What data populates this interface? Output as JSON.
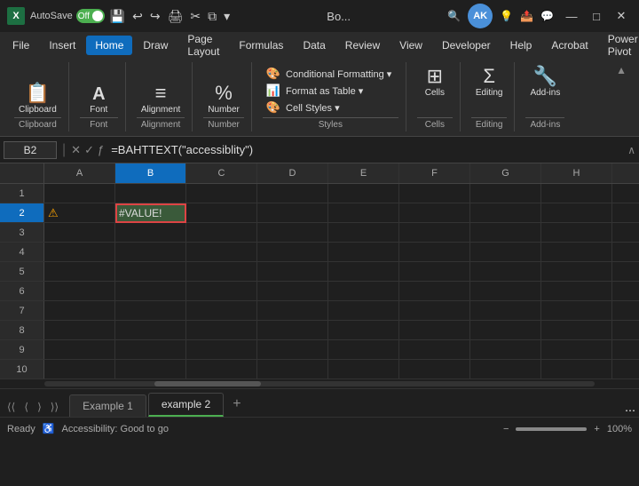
{
  "titlebar": {
    "app_icon": "X",
    "autosave_label": "AutoSave",
    "toggle_state": "Off",
    "filename": "Bo...",
    "window_controls": {
      "minimize": "—",
      "maximize": "□",
      "close": "✕"
    }
  },
  "menubar": {
    "items": [
      {
        "id": "file",
        "label": "File"
      },
      {
        "id": "insert",
        "label": "Insert"
      },
      {
        "id": "home",
        "label": "Home",
        "active": true
      },
      {
        "id": "draw",
        "label": "Draw"
      },
      {
        "id": "page-layout",
        "label": "Page Layout"
      },
      {
        "id": "formulas",
        "label": "Formulas"
      },
      {
        "id": "data",
        "label": "Data"
      },
      {
        "id": "review",
        "label": "Review"
      },
      {
        "id": "view",
        "label": "View"
      },
      {
        "id": "developer",
        "label": "Developer"
      },
      {
        "id": "help",
        "label": "Help"
      },
      {
        "id": "acrobat",
        "label": "Acrobat"
      },
      {
        "id": "power-pivot",
        "label": "Power Pivot"
      }
    ]
  },
  "ribbon": {
    "groups": [
      {
        "id": "clipboard",
        "label": "Clipboard",
        "icon": "📋"
      },
      {
        "id": "font",
        "label": "Font",
        "icon": "A"
      },
      {
        "id": "alignment",
        "label": "Alignment",
        "icon": "≡"
      },
      {
        "id": "number",
        "label": "Number",
        "icon": "%"
      },
      {
        "id": "styles",
        "label": "Styles",
        "items": [
          {
            "icon": "🎨",
            "label": "Conditional Formatting ▾"
          },
          {
            "icon": "📊",
            "label": "Format as Table ▾"
          },
          {
            "icon": "🎨",
            "label": "Cell Styles ▾"
          }
        ]
      },
      {
        "id": "cells",
        "label": "Cells",
        "icon": "⊞"
      },
      {
        "id": "editing",
        "label": "Editing",
        "icon": "Σ"
      },
      {
        "id": "add-ins",
        "label": "Add-ins",
        "icon": "🔧"
      }
    ],
    "section_labels": {
      "styles": "Styles",
      "add_ins": "Add-ins"
    }
  },
  "formula_bar": {
    "cell_ref": "B2",
    "formula": "=BAHTTEXT(\"accessiblity\")",
    "icons": [
      "✕",
      "✓",
      "ƒ"
    ]
  },
  "spreadsheet": {
    "col_headers": [
      "A",
      "B",
      "C",
      "D",
      "E",
      "F",
      "G",
      "H"
    ],
    "active_col": "B",
    "rows": [
      1,
      2,
      3,
      4,
      5,
      6,
      7,
      8,
      9,
      10
    ],
    "active_row": 2,
    "selected_cell": {
      "row": 2,
      "col": "B",
      "value": "#VALUE!",
      "has_warning": true
    }
  },
  "sheet_tabs": {
    "tabs": [
      {
        "id": "example1",
        "label": "Example 1",
        "active": false
      },
      {
        "id": "example2",
        "label": "example 2",
        "active": true
      }
    ],
    "add_label": "+"
  },
  "status_bar": {
    "ready": "Ready",
    "accessibility": "Accessibility: Good to go",
    "zoom": "100%"
  }
}
